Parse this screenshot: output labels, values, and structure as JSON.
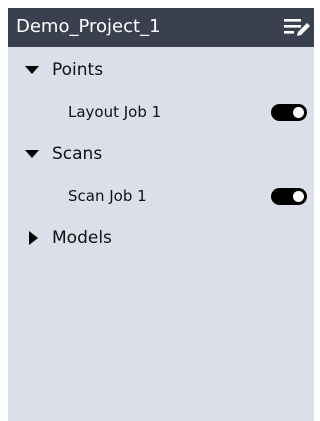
{
  "header": {
    "title": "Demo_Project_1",
    "edit_icon": "edit-list-icon"
  },
  "tree": {
    "points": {
      "label": "Points",
      "expanded": true,
      "item": {
        "label": "Layout Job 1",
        "visible": true
      }
    },
    "scans": {
      "label": "Scans",
      "expanded": true,
      "item": {
        "label": "Scan Job 1",
        "visible": true
      }
    },
    "models": {
      "label": "Models",
      "expanded": false
    }
  },
  "colors": {
    "header_bg": "#3b4050",
    "panel_bg": "#dadfea",
    "toggle_on": "#000000"
  }
}
